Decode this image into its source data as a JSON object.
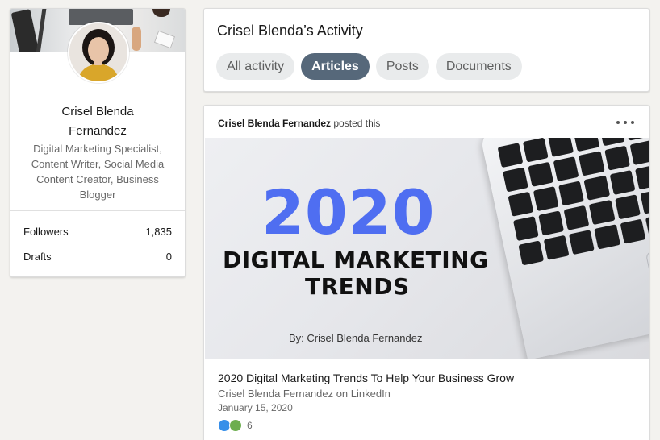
{
  "profile": {
    "name": "Crisel Blenda Fernandez",
    "headline": "Digital Marketing Specialist, Content Writer, Social Media Content Creator, Business Blogger",
    "stats": [
      {
        "label": "Followers",
        "value": "1,835"
      },
      {
        "label": "Drafts",
        "value": "0"
      }
    ]
  },
  "activity": {
    "title": "Crisel Blenda’s Activity",
    "tabs": [
      {
        "label": "All activity",
        "active": false
      },
      {
        "label": "Articles",
        "active": true
      },
      {
        "label": "Posts",
        "active": false
      },
      {
        "label": "Documents",
        "active": false
      }
    ]
  },
  "post": {
    "author": "Crisel Blenda Fernandez",
    "action": " posted this",
    "image": {
      "year": "2020",
      "line1": "DIGITAL MARKETING",
      "line2": "TRENDS",
      "byline": "By: Crisel Blenda Fernandez"
    },
    "article_title": "2020 Digital Marketing Trends To Help Your Business Grow",
    "source": "Crisel Blenda Fernandez on LinkedIn",
    "date": "January 15, 2020",
    "reaction_count": "6",
    "reaction_icons": [
      "like-icon",
      "support-icon"
    ]
  },
  "colors": {
    "active_pill": "#56687a",
    "year_blue": "#4f6ef1",
    "background": "#f3f2ef"
  }
}
